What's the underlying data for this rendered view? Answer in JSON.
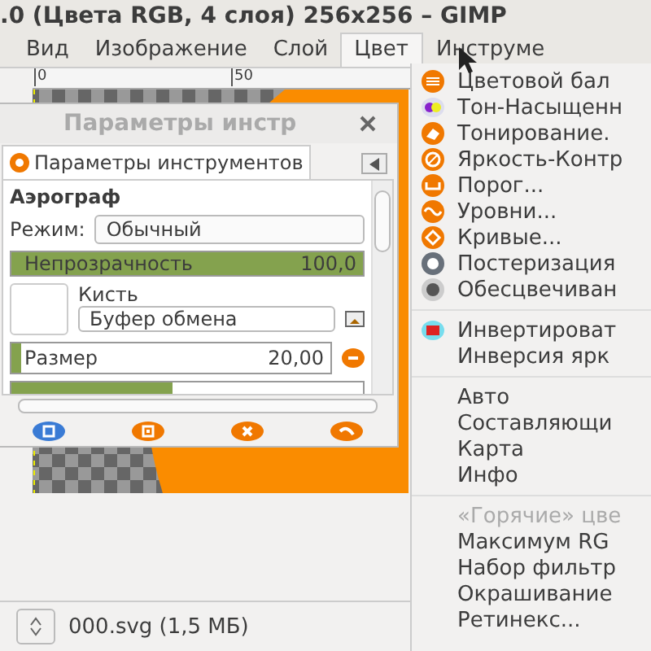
{
  "window": {
    "title": ".0 (Цвета RGB, 4 слоя) 256x256 – GIMP"
  },
  "menubar": [
    {
      "label": "Вид",
      "selected": false
    },
    {
      "label": "Изображение",
      "selected": false
    },
    {
      "label": "Слой",
      "selected": false
    },
    {
      "label": "Цвет",
      "selected": true
    },
    {
      "label": "Инструме",
      "selected": false
    }
  ],
  "ruler": {
    "marks": [
      "0",
      "50"
    ]
  },
  "tool_options": {
    "title": "Параметры инстр",
    "tab": "Параметры инструментов",
    "tool": "Аэрограф",
    "mode_label": "Режим:",
    "mode": "Обычный",
    "sliders": [
      {
        "label": "Непрозрачность",
        "reading": "100,0",
        "level": 1.0
      },
      {
        "label": "Размер",
        "reading": "20,00",
        "level": 0.03
      },
      {
        "level": 0.46
      }
    ],
    "brush_label": "Кисть",
    "brush": "Буфер обмена"
  },
  "color_menu": [
    {
      "label": "Цветовой бал",
      "disabled": false
    },
    {
      "label": "Тон-Насыщенн",
      "disabled": false
    },
    {
      "label": "Тонирование.",
      "disabled": false
    },
    {
      "label": "Яркость-Контр",
      "disabled": false
    },
    {
      "label": "Порог...",
      "disabled": false
    },
    {
      "label": "Уровни...",
      "disabled": false
    },
    {
      "label": "Кривые...",
      "disabled": false
    },
    {
      "label": "Постеризация",
      "disabled": false
    },
    {
      "label": "Обесцвечиван",
      "disabled": false
    },
    {
      "kind": "separator"
    },
    {
      "label": "Инвертироват",
      "disabled": false
    },
    {
      "label": "Инверсия ярк",
      "disabled": false
    },
    {
      "kind": "separator"
    },
    {
      "label": "Авто",
      "disabled": false
    },
    {
      "label": "Составляющи",
      "disabled": false
    },
    {
      "label": "Карта",
      "disabled": false
    },
    {
      "label": "Инфо",
      "disabled": false
    },
    {
      "kind": "separator"
    },
    {
      "label": "«Горячие» цве",
      "disabled": true
    },
    {
      "label": "Максимум RG",
      "disabled": false
    },
    {
      "label": "Набор фильтр",
      "disabled": false
    },
    {
      "label": "Окрашивание",
      "disabled": false
    },
    {
      "label": "Ретинекс...",
      "disabled": false
    }
  ],
  "status_bar": {
    "file": "000.svg (1,5 МБ)"
  }
}
